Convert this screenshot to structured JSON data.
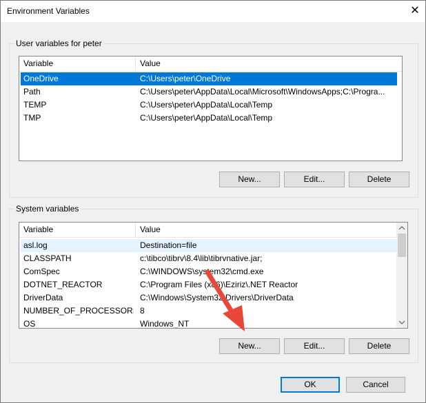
{
  "window": {
    "title": "Environment Variables",
    "close_glyph": "✕"
  },
  "user_vars": {
    "group_label": "User variables for peter",
    "columns": [
      "Variable",
      "Value"
    ],
    "rows": [
      {
        "variable": "OneDrive",
        "value": "C:\\Users\\peter\\OneDrive",
        "selected": true
      },
      {
        "variable": "Path",
        "value": "C:\\Users\\peter\\AppData\\Local\\Microsoft\\WindowsApps;C:\\Progra..."
      },
      {
        "variable": "TEMP",
        "value": "C:\\Users\\peter\\AppData\\Local\\Temp"
      },
      {
        "variable": "TMP",
        "value": "C:\\Users\\peter\\AppData\\Local\\Temp"
      }
    ],
    "buttons": {
      "new": "New...",
      "edit": "Edit...",
      "delete": "Delete"
    }
  },
  "system_vars": {
    "group_label": "System variables",
    "columns": [
      "Variable",
      "Value"
    ],
    "rows": [
      {
        "variable": "asl.log",
        "value": "Destination=file",
        "hover": true
      },
      {
        "variable": "CLASSPATH",
        "value": "c:\\tibco\\tibrv\\8.4\\lib\\tibrvnative.jar;"
      },
      {
        "variable": "ComSpec",
        "value": "C:\\WINDOWS\\system32\\cmd.exe"
      },
      {
        "variable": "DOTNET_REACTOR",
        "value": "C:\\Program Files (x86)\\Eziriz\\.NET Reactor"
      },
      {
        "variable": "DriverData",
        "value": "C:\\Windows\\System32\\Drivers\\DriverData"
      },
      {
        "variable": "NUMBER_OF_PROCESSORS",
        "value": "8"
      },
      {
        "variable": "OS",
        "value": "Windows_NT"
      }
    ],
    "buttons": {
      "new": "New...",
      "edit": "Edit...",
      "delete": "Delete"
    }
  },
  "footer": {
    "ok": "OK",
    "cancel": "Cancel"
  },
  "colors": {
    "selection": "#0078d7",
    "annotation_arrow": "#e8473a"
  }
}
